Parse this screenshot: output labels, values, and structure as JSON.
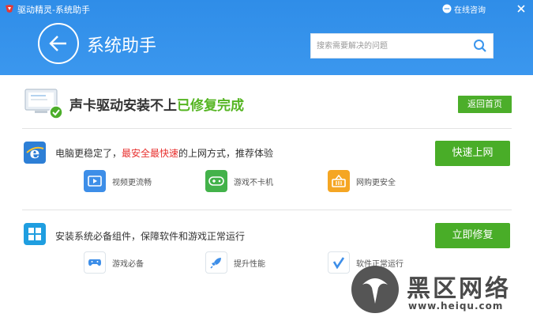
{
  "window": {
    "title": "驱动精灵-系统助手",
    "consult_label": "在线咨询",
    "icons": {
      "logo": "app-logo-icon",
      "consult": "chat-bubble-icon",
      "close": "close-icon"
    }
  },
  "header": {
    "page_title": "系统助手",
    "search_placeholder": "搜索需要解决的问题",
    "search_value": "",
    "colors": {
      "background": "#3a95ed"
    }
  },
  "status": {
    "text_prefix": "声卡驱动安装不上",
    "text_done": "已修复完成",
    "home_button": "返回首页",
    "colors": {
      "done": "#55b522",
      "button": "#4cae2a"
    }
  },
  "sections": [
    {
      "icon": "ie-browser-icon",
      "text_prefix": "电脑更稳定了，",
      "text_highlight": "最安全最快速",
      "text_suffix": "的上网方式，推荐体验",
      "button": "快速上网",
      "features": [
        {
          "icon": "video-icon",
          "label": "视频更流畅",
          "color": "#3d8ee8"
        },
        {
          "icon": "gamepad-icon",
          "label": "游戏不卡机",
          "color": "#43b24a"
        },
        {
          "icon": "shopping-basket-icon",
          "label": "网购更安全",
          "color": "#f5a623"
        }
      ]
    },
    {
      "icon": "windows-logo-icon",
      "text_prefix": "安装系统必备组件，保障软件和游戏正常运行",
      "text_highlight": "",
      "text_suffix": "",
      "button": "立即修复",
      "features": [
        {
          "icon": "game-controller-icon",
          "label": "游戏必备",
          "color": "#3d8ee8"
        },
        {
          "icon": "rocket-icon",
          "label": "提升性能",
          "color": "#3d8ee8"
        },
        {
          "icon": "checkmark-icon",
          "label": "软件正常运行",
          "color": "#3d8ee8"
        }
      ]
    }
  ],
  "watermark": {
    "text": "黑区网络",
    "url": "www.heiqu.com"
  }
}
